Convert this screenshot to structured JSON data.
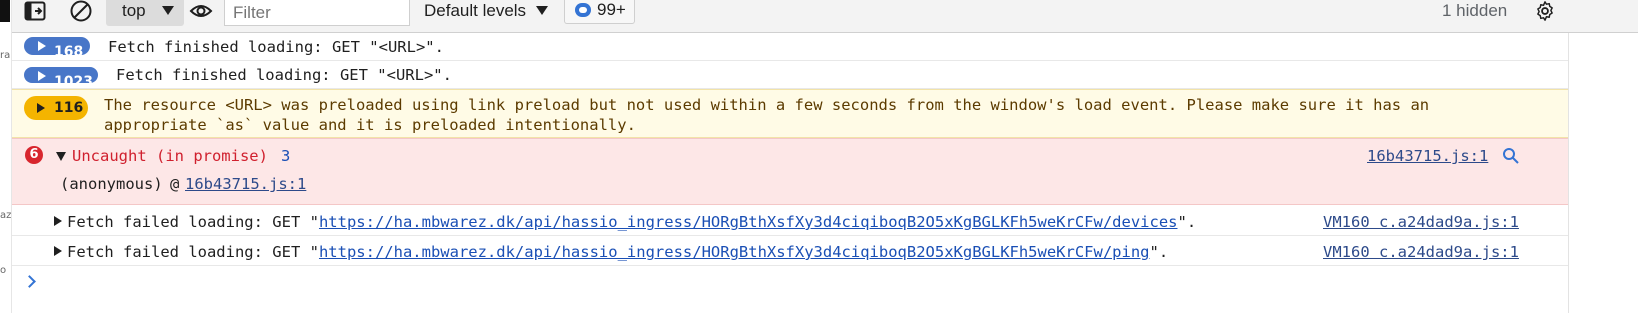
{
  "edge": {
    "texts": [
      "ra",
      "az",
      "o"
    ]
  },
  "toolbar": {
    "context": "top",
    "filter_placeholder": "Filter",
    "levels": "Default levels",
    "issues_count": "99+",
    "hidden": "1 hidden",
    "icons": [
      "toggle-sidebar-icon",
      "clear-console-icon",
      "live-expression-eye-icon",
      "settings-gear-icon"
    ]
  },
  "messages": [
    {
      "type": "log",
      "count": "168",
      "text": "Fetch finished loading: GET \"<URL>\"."
    },
    {
      "type": "log",
      "count": "1023",
      "text": "Fetch finished loading: GET \"<URL>\"."
    },
    {
      "type": "warning",
      "count": "116",
      "line1": "The resource <URL> was preloaded using link preload but not used within a few seconds from the window's load event. Please make sure it has an",
      "line2": "appropriate `as` value and it is preloaded intentionally."
    },
    {
      "type": "error",
      "badge": "6",
      "title": "Uncaught (in promise)",
      "value": "3",
      "source": "16b43715.js:1",
      "stack_fn": "(anonymous)",
      "stack_at": "@",
      "stack_src": "16b43715.js:1"
    },
    {
      "type": "log",
      "prefix": "Fetch failed loading: GET \"",
      "url": "https://ha.mbwarez.dk/api/hassio_ingress/HORgBthXsfXy3d4ciqiboqB2O5xKgBGLKFh5weKrCFw/devices",
      "suffix": "\".",
      "source": "VM160 c.a24dad9a.js:1"
    },
    {
      "type": "log",
      "prefix": "Fetch failed loading: GET \"",
      "url": "https://ha.mbwarez.dk/api/hassio_ingress/HORgBthXsfXy3d4ciqiboqB2O5xKgBGLKFh5weKrCFw/ping",
      "suffix": "\".",
      "source": "VM160 c.a24dad9a.js:1"
    }
  ],
  "colors": {
    "warning_bg": "#fffbe6",
    "error_bg": "#fde7e7",
    "pill_blue": "#4876c8",
    "pill_warn": "#f4b400",
    "error_red": "#d8262e",
    "link": "#1a4fb5"
  }
}
